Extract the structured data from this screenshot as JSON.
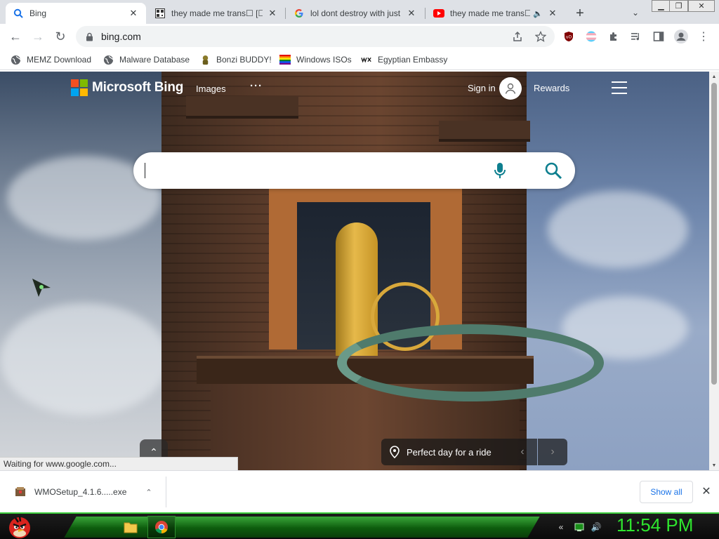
{
  "tabs": [
    {
      "title": "Bing",
      "favicon": "bing-search-icon",
      "active": true
    },
    {
      "title": "they made me trans☐ [☐ ☐",
      "favicon": "qr-icon",
      "active": false
    },
    {
      "title": "lol dont destroy with just",
      "favicon": "google-icon",
      "active": false
    },
    {
      "title": "they made me trans☐",
      "favicon": "youtube-icon",
      "active": false,
      "audio": "🔈"
    }
  ],
  "tabstrip": {
    "new_tab": "+",
    "tab_search": "⌄",
    "close": "✕"
  },
  "window_controls": {
    "minimize": "▁",
    "maximize": "❐",
    "close": "✕"
  },
  "toolbar": {
    "back": "←",
    "forward": "→",
    "reload": "↻",
    "url": "bing.com",
    "menu": "⋮"
  },
  "bookmarks": [
    {
      "label": "MEMZ Download",
      "icon": "globe-icon"
    },
    {
      "label": "Malware Database",
      "icon": "globe-icon"
    },
    {
      "label": "Bonzi BUDDY!",
      "icon": "bonzi-icon"
    },
    {
      "label": "Windows ISOs",
      "icon": "rainbow-flag-icon"
    },
    {
      "label": "Egyptian Embassy",
      "icon": "wix-icon"
    }
  ],
  "bing": {
    "brand": "Microsoft Bing",
    "nav_images": "Images",
    "nav_more": "···",
    "sign_in": "Sign in",
    "rewards": "Rewards",
    "search_value": "",
    "caption": "Perfect day for a ride",
    "prev": "‹",
    "next": "›",
    "scroll_up": "⌃",
    "logo_colors": [
      "#f25022",
      "#7fba00",
      "#00a4ef",
      "#ffb900"
    ],
    "accent": "#0e7f8f"
  },
  "status": {
    "text": "Waiting for www.google.com..."
  },
  "scrollbar": {
    "up": "▲",
    "down": "▼"
  },
  "downloads": {
    "file_name": "WMOSetup_4.1.6.....exe",
    "menu": "⌃",
    "show_all": "Show all",
    "close": "✕"
  },
  "taskbar": {
    "clock": "11:54 PM",
    "tray": {
      "keyboard": "«",
      "speaker": "🔊"
    }
  }
}
